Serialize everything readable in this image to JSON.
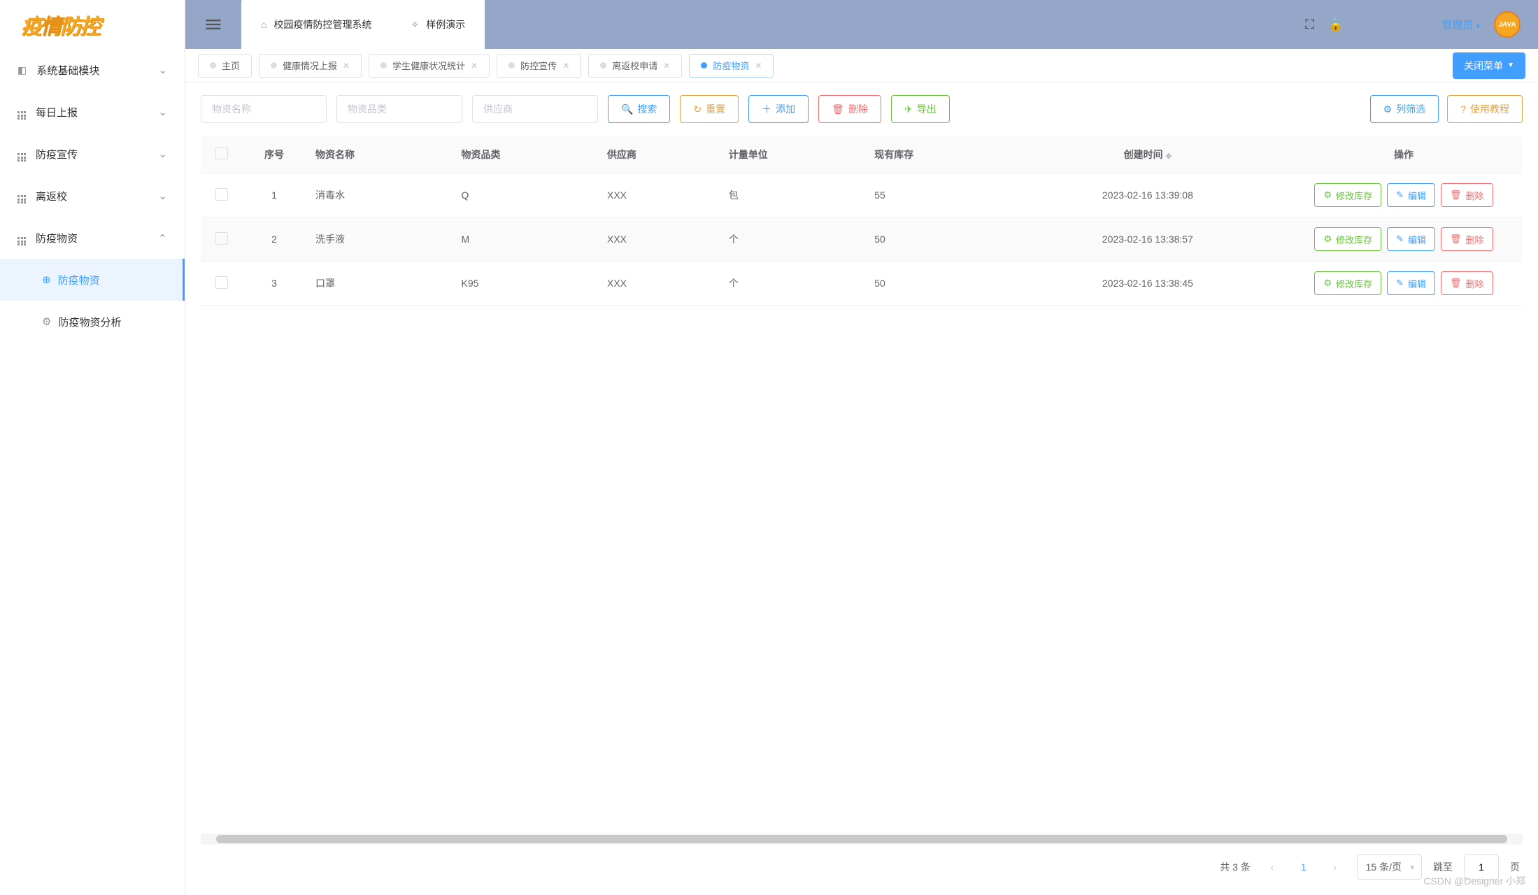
{
  "logo": "疫情防控",
  "sidebar": {
    "items": [
      {
        "label": "系统基础模块",
        "expanded": false
      },
      {
        "label": "每日上报",
        "expanded": false
      },
      {
        "label": "防疫宣传",
        "expanded": false
      },
      {
        "label": "离返校",
        "expanded": false
      },
      {
        "label": "防疫物资",
        "expanded": true,
        "children": [
          {
            "label": "防疫物资",
            "active": true
          },
          {
            "label": "防疫物资分析",
            "active": false
          }
        ]
      }
    ]
  },
  "topTabs": [
    {
      "label": "校园疫情防控管理系统",
      "icon": "home"
    },
    {
      "label": "样例演示",
      "icon": "sparkle"
    }
  ],
  "adminLabel": "管理员",
  "avatarText": "JAVA",
  "viewTabs": [
    {
      "label": "主页",
      "closable": false,
      "active": false
    },
    {
      "label": "健康情况上报",
      "closable": true,
      "active": false
    },
    {
      "label": "学生健康状况统计",
      "closable": true,
      "active": false
    },
    {
      "label": "防控宣传",
      "closable": true,
      "active": false
    },
    {
      "label": "离返校申请",
      "closable": true,
      "active": false
    },
    {
      "label": "防疫物资",
      "closable": true,
      "active": true
    }
  ],
  "closeMenuLabel": "关闭菜单",
  "filters": {
    "name_ph": "物资名称",
    "category_ph": "物资品类",
    "supplier_ph": "供应商"
  },
  "buttons": {
    "search": "搜索",
    "reset": "重置",
    "add": "添加",
    "delete": "删除",
    "export": "导出",
    "columns": "列筛选",
    "tutorial": "使用教程",
    "modifyStock": "修改库存",
    "edit": "编辑",
    "rowDelete": "删除"
  },
  "table": {
    "headers": {
      "seq": "序号",
      "name": "物资名称",
      "category": "物资品类",
      "supplier": "供应商",
      "unit": "计量单位",
      "stock": "现有库存",
      "created": "创建时间",
      "actions": "操作"
    },
    "rows": [
      {
        "seq": "1",
        "name": "消毒水",
        "category": "Q",
        "supplier": "XXX",
        "unit": "包",
        "stock": "55",
        "created": "2023-02-16 13:39:08"
      },
      {
        "seq": "2",
        "name": "洗手液",
        "category": "M",
        "supplier": "XXX",
        "unit": "个",
        "stock": "50",
        "created": "2023-02-16 13:38:57"
      },
      {
        "seq": "3",
        "name": "口罩",
        "category": "K95",
        "supplier": "XXX",
        "unit": "个",
        "stock": "50",
        "created": "2023-02-16 13:38:45"
      }
    ]
  },
  "pagination": {
    "total": "共 3 条",
    "page": "1",
    "perPage": "15 条/页",
    "jumpLabel": "跳至",
    "jumpValue": "1",
    "pageSuffix": "页"
  },
  "watermark": "CSDN @Designer 小郑"
}
